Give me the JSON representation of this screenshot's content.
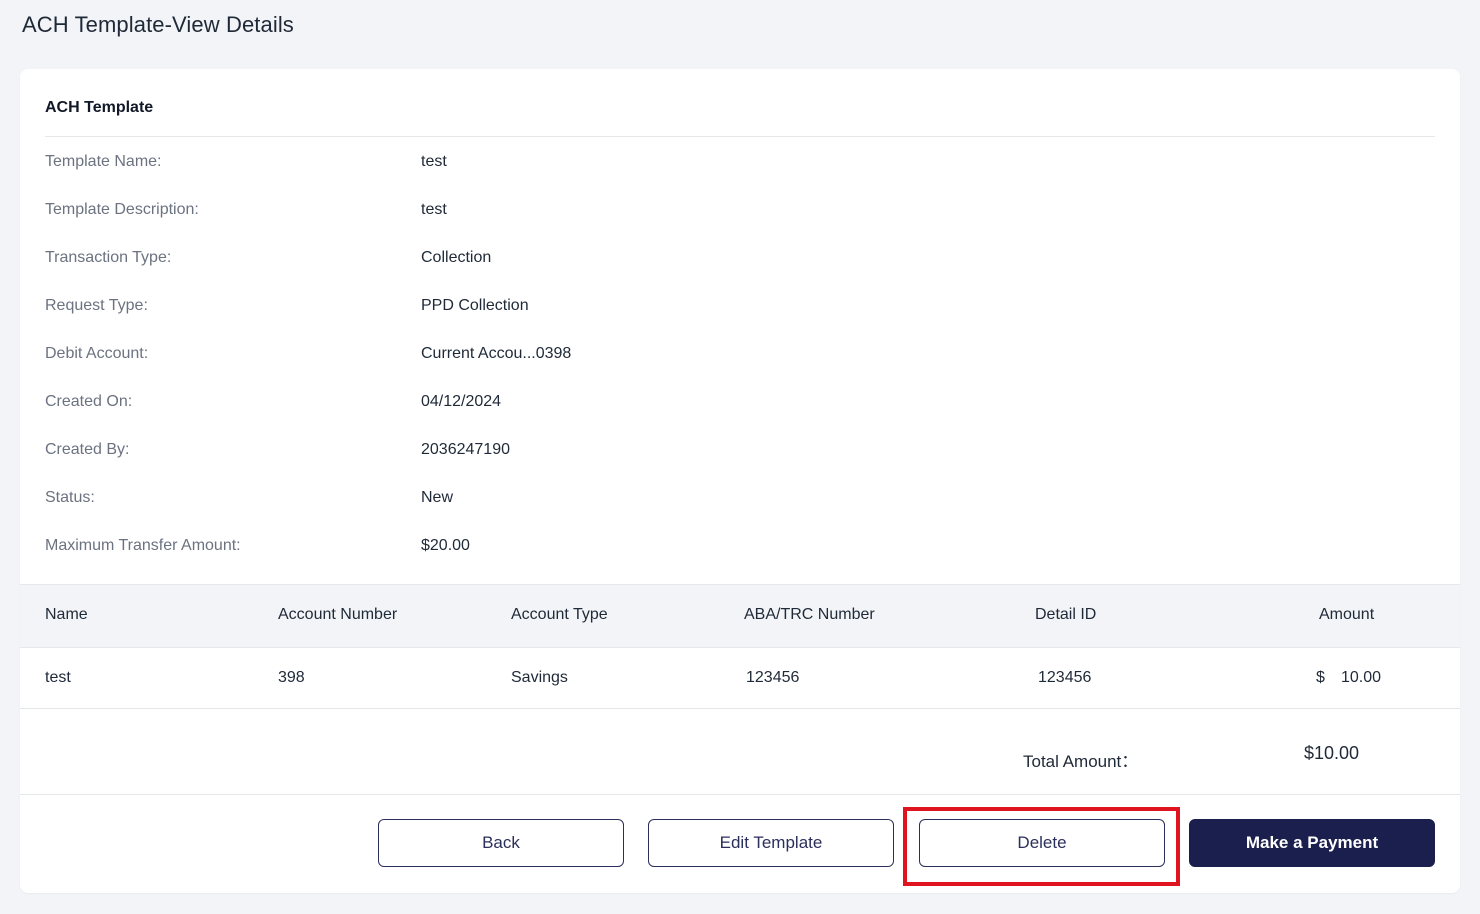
{
  "page": {
    "title": "ACH Template-View Details"
  },
  "template": {
    "section_title": "ACH Template",
    "details": [
      {
        "label": "Template Name:",
        "value": "test"
      },
      {
        "label": "Template Description:",
        "value": "test"
      },
      {
        "label": "Transaction Type:",
        "value": "Collection"
      },
      {
        "label": "Request Type:",
        "value": "PPD Collection"
      },
      {
        "label": "Debit Account:",
        "value": "Current Accou...0398"
      },
      {
        "label": "Created On:",
        "value": "04/12/2024"
      },
      {
        "label": "Created By:",
        "value": "2036247190"
      },
      {
        "label": "Status:",
        "value": "New"
      },
      {
        "label": "Maximum Transfer Amount:",
        "value": "$20.00"
      }
    ]
  },
  "table": {
    "headers": [
      "Name",
      "Account Number",
      "Account Type",
      "ABA/TRC Number",
      "Detail ID",
      "Amount"
    ],
    "rows": [
      {
        "name": "test",
        "account_number": "398",
        "account_type": "Savings",
        "aba_trc": "123456",
        "detail_id": "123456",
        "currency": "$",
        "amount": "10.00"
      }
    ],
    "total_label": "Total Amount：",
    "total_value": "$10.00"
  },
  "actions": {
    "back": "Back",
    "edit": "Edit Template",
    "delete": "Delete",
    "payment": "Make a Payment"
  },
  "colors": {
    "page_bg": "#f2f4f7",
    "card_bg": "#ffffff",
    "primary": "#1b1f4e",
    "highlight": "#e0141e",
    "muted_text": "#6b7280"
  }
}
